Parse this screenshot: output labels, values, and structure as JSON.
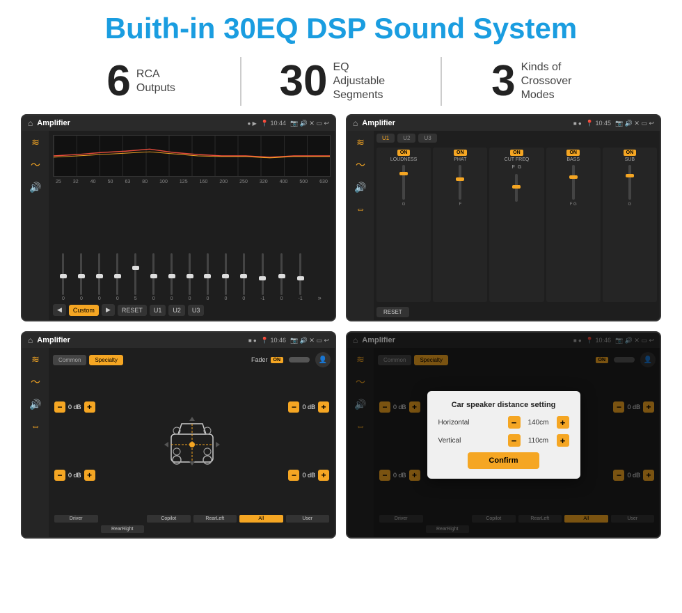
{
  "header": {
    "title": "Buith-in 30EQ DSP Sound System"
  },
  "stats": [
    {
      "number": "6",
      "label": "RCA\nOutputs"
    },
    {
      "number": "30",
      "label": "EQ Adjustable\nSegments"
    },
    {
      "number": "3",
      "label": "Kinds of\nCrossover Modes"
    }
  ],
  "screens": [
    {
      "id": "eq-screen",
      "statusBar": {
        "appName": "Amplifier",
        "time": "10:44"
      },
      "eq": {
        "frequencies": [
          "25",
          "32",
          "40",
          "50",
          "63",
          "80",
          "100",
          "125",
          "160",
          "200",
          "250",
          "320",
          "400",
          "500",
          "630"
        ],
        "values": [
          "0",
          "0",
          "0",
          "0",
          "5",
          "0",
          "0",
          "0",
          "0",
          "0",
          "0",
          "0",
          "0",
          "-1",
          "0",
          "-1"
        ],
        "mode": "Custom",
        "presets": [
          "Custom",
          "RESET",
          "U1",
          "U2",
          "U3"
        ]
      }
    },
    {
      "id": "amp-crossover",
      "statusBar": {
        "appName": "Amplifier",
        "time": "10:45"
      },
      "channels": [
        {
          "name": "LOUDNESS",
          "on": true
        },
        {
          "name": "PHAT",
          "on": true
        },
        {
          "name": "CUT FREQ",
          "on": true
        },
        {
          "name": "BASS",
          "on": true
        },
        {
          "name": "SUB",
          "on": true
        }
      ],
      "presets": [
        "U1",
        "U2",
        "U3"
      ],
      "resetLabel": "RESET"
    },
    {
      "id": "fader-screen",
      "statusBar": {
        "appName": "Amplifier",
        "time": "10:46"
      },
      "tabs": [
        "Common",
        "Specialty"
      ],
      "faderLabel": "Fader",
      "faderOn": "ON",
      "zones": [
        {
          "label": "Driver",
          "active": false
        },
        {
          "label": "Copilot",
          "active": false
        },
        {
          "label": "RearLeft",
          "active": false
        },
        {
          "label": "All",
          "active": true
        },
        {
          "label": "User",
          "active": false
        },
        {
          "label": "RearRight",
          "active": false
        }
      ],
      "speakers": [
        {
          "label": "0 dB",
          "pos": "FL"
        },
        {
          "label": "0 dB",
          "pos": "FR"
        },
        {
          "label": "0 dB",
          "pos": "RL"
        },
        {
          "label": "0 dB",
          "pos": "RR"
        }
      ]
    },
    {
      "id": "distance-screen",
      "statusBar": {
        "appName": "Amplifier",
        "time": "10:46"
      },
      "tabs": [
        "Common",
        "Specialty"
      ],
      "faderOn": "ON",
      "dialog": {
        "title": "Car speaker distance setting",
        "fields": [
          {
            "label": "Horizontal",
            "value": "140cm"
          },
          {
            "label": "Vertical",
            "value": "110cm"
          }
        ],
        "confirmLabel": "Confirm"
      },
      "zones": [
        {
          "label": "Driver",
          "active": false
        },
        {
          "label": "Copilot",
          "active": false
        },
        {
          "label": "RearLeft",
          "active": false
        },
        {
          "label": "All",
          "active": true
        },
        {
          "label": "User",
          "active": false
        },
        {
          "label": "RearRight",
          "active": false
        }
      ]
    }
  ],
  "icons": {
    "home": "⌂",
    "back": "↩",
    "location": "📍",
    "speaker": "🔊",
    "close": "✕",
    "minimize": "—",
    "eq": "≋",
    "wave": "〜",
    "arrows": "⇔",
    "chevronLeft": "◀",
    "chevronRight": "▶",
    "plus": "+",
    "minus": "−",
    "user": "👤",
    "forward": "▶",
    "backward": "◀",
    "settings": "⚙"
  }
}
